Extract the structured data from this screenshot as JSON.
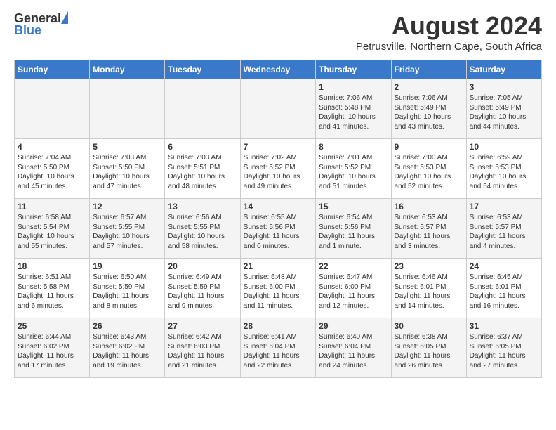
{
  "header": {
    "logo_general": "General",
    "logo_blue": "Blue",
    "month_title": "August 2024",
    "subtitle": "Petrusville, Northern Cape, South Africa"
  },
  "calendar": {
    "days_of_week": [
      "Sunday",
      "Monday",
      "Tuesday",
      "Wednesday",
      "Thursday",
      "Friday",
      "Saturday"
    ],
    "weeks": [
      [
        {
          "day": "",
          "info": ""
        },
        {
          "day": "",
          "info": ""
        },
        {
          "day": "",
          "info": ""
        },
        {
          "day": "",
          "info": ""
        },
        {
          "day": "1",
          "info": "Sunrise: 7:06 AM\nSunset: 5:48 PM\nDaylight: 10 hours and 41 minutes."
        },
        {
          "day": "2",
          "info": "Sunrise: 7:06 AM\nSunset: 5:49 PM\nDaylight: 10 hours and 43 minutes."
        },
        {
          "day": "3",
          "info": "Sunrise: 7:05 AM\nSunset: 5:49 PM\nDaylight: 10 hours and 44 minutes."
        }
      ],
      [
        {
          "day": "4",
          "info": "Sunrise: 7:04 AM\nSunset: 5:50 PM\nDaylight: 10 hours and 45 minutes."
        },
        {
          "day": "5",
          "info": "Sunrise: 7:03 AM\nSunset: 5:50 PM\nDaylight: 10 hours and 47 minutes."
        },
        {
          "day": "6",
          "info": "Sunrise: 7:03 AM\nSunset: 5:51 PM\nDaylight: 10 hours and 48 minutes."
        },
        {
          "day": "7",
          "info": "Sunrise: 7:02 AM\nSunset: 5:52 PM\nDaylight: 10 hours and 49 minutes."
        },
        {
          "day": "8",
          "info": "Sunrise: 7:01 AM\nSunset: 5:52 PM\nDaylight: 10 hours and 51 minutes."
        },
        {
          "day": "9",
          "info": "Sunrise: 7:00 AM\nSunset: 5:53 PM\nDaylight: 10 hours and 52 minutes."
        },
        {
          "day": "10",
          "info": "Sunrise: 6:59 AM\nSunset: 5:53 PM\nDaylight: 10 hours and 54 minutes."
        }
      ],
      [
        {
          "day": "11",
          "info": "Sunrise: 6:58 AM\nSunset: 5:54 PM\nDaylight: 10 hours and 55 minutes."
        },
        {
          "day": "12",
          "info": "Sunrise: 6:57 AM\nSunset: 5:55 PM\nDaylight: 10 hours and 57 minutes."
        },
        {
          "day": "13",
          "info": "Sunrise: 6:56 AM\nSunset: 5:55 PM\nDaylight: 10 hours and 58 minutes."
        },
        {
          "day": "14",
          "info": "Sunrise: 6:55 AM\nSunset: 5:56 PM\nDaylight: 11 hours and 0 minutes."
        },
        {
          "day": "15",
          "info": "Sunrise: 6:54 AM\nSunset: 5:56 PM\nDaylight: 11 hours and 1 minute."
        },
        {
          "day": "16",
          "info": "Sunrise: 6:53 AM\nSunset: 5:57 PM\nDaylight: 11 hours and 3 minutes."
        },
        {
          "day": "17",
          "info": "Sunrise: 6:53 AM\nSunset: 5:57 PM\nDaylight: 11 hours and 4 minutes."
        }
      ],
      [
        {
          "day": "18",
          "info": "Sunrise: 6:51 AM\nSunset: 5:58 PM\nDaylight: 11 hours and 6 minutes."
        },
        {
          "day": "19",
          "info": "Sunrise: 6:50 AM\nSunset: 5:59 PM\nDaylight: 11 hours and 8 minutes."
        },
        {
          "day": "20",
          "info": "Sunrise: 6:49 AM\nSunset: 5:59 PM\nDaylight: 11 hours and 9 minutes."
        },
        {
          "day": "21",
          "info": "Sunrise: 6:48 AM\nSunset: 6:00 PM\nDaylight: 11 hours and 11 minutes."
        },
        {
          "day": "22",
          "info": "Sunrise: 6:47 AM\nSunset: 6:00 PM\nDaylight: 11 hours and 12 minutes."
        },
        {
          "day": "23",
          "info": "Sunrise: 6:46 AM\nSunset: 6:01 PM\nDaylight: 11 hours and 14 minutes."
        },
        {
          "day": "24",
          "info": "Sunrise: 6:45 AM\nSunset: 6:01 PM\nDaylight: 11 hours and 16 minutes."
        }
      ],
      [
        {
          "day": "25",
          "info": "Sunrise: 6:44 AM\nSunset: 6:02 PM\nDaylight: 11 hours and 17 minutes."
        },
        {
          "day": "26",
          "info": "Sunrise: 6:43 AM\nSunset: 6:02 PM\nDaylight: 11 hours and 19 minutes."
        },
        {
          "day": "27",
          "info": "Sunrise: 6:42 AM\nSunset: 6:03 PM\nDaylight: 11 hours and 21 minutes."
        },
        {
          "day": "28",
          "info": "Sunrise: 6:41 AM\nSunset: 6:04 PM\nDaylight: 11 hours and 22 minutes."
        },
        {
          "day": "29",
          "info": "Sunrise: 6:40 AM\nSunset: 6:04 PM\nDaylight: 11 hours and 24 minutes."
        },
        {
          "day": "30",
          "info": "Sunrise: 6:38 AM\nSunset: 6:05 PM\nDaylight: 11 hours and 26 minutes."
        },
        {
          "day": "31",
          "info": "Sunrise: 6:37 AM\nSunset: 6:05 PM\nDaylight: 11 hours and 27 minutes."
        }
      ]
    ]
  }
}
